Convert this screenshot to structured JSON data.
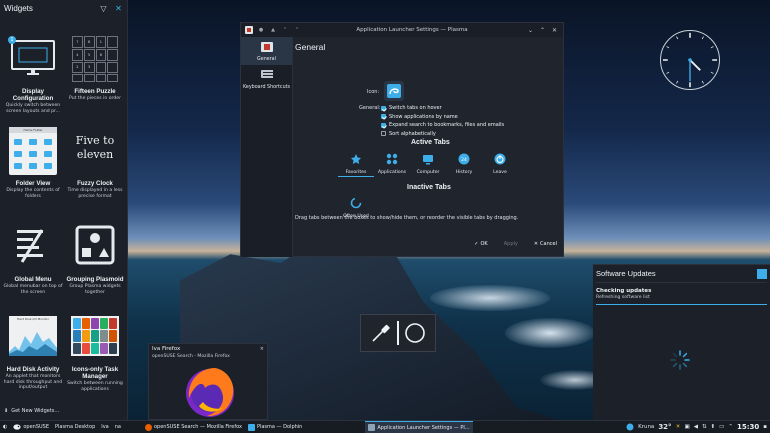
{
  "widgets_panel": {
    "title": "Widgets",
    "items": [
      {
        "name": "Display Configuration",
        "desc": "Quickly switch between screen layouts and pr...",
        "badge": "1"
      },
      {
        "name": "Fifteen Puzzle",
        "desc": "Put the pieces in order"
      },
      {
        "name": "Folder View",
        "desc": "Display the contents of folders",
        "thumb_label": "Home Folder"
      },
      {
        "name": "Fuzzy Clock",
        "desc": "Time displayed in a less precise format",
        "thumb_text_1": "Five to",
        "thumb_text_2": "eleven"
      },
      {
        "name": "Global Menu",
        "desc": "Global menubar on top of the screen"
      },
      {
        "name": "Grouping Plasmoid",
        "desc": "Group Plasma widgets together"
      },
      {
        "name": "Hard Disk Activity",
        "desc": "An applet that monitors hard disk throughput and input/output",
        "thumb_label": "Hard Disk I/O Monitor"
      },
      {
        "name": "Icons-only Task Manager",
        "desc": "Switch between running applications"
      }
    ],
    "puzzle_numbers": [
      "7",
      "8",
      "1",
      "",
      "4",
      "5",
      "6",
      "",
      "2",
      "3",
      "",
      "",
      "",
      "",
      "",
      ""
    ],
    "get_new": "Get New Widgets..."
  },
  "dialog": {
    "title": "Application Launcher Settings — Plasma",
    "sidebar": [
      {
        "label": "General"
      },
      {
        "label": "Keyboard Shortcuts"
      }
    ],
    "heading": "General",
    "icon_label": "Icon:",
    "general_label": "General:",
    "checks": [
      {
        "label": "Switch tabs on hover",
        "checked": true
      },
      {
        "label": "Show applications by name",
        "checked": true
      },
      {
        "label": "Expand search to bookmarks, files and emails",
        "checked": true
      },
      {
        "label": "Sort alphabetically",
        "checked": false
      }
    ],
    "active_tabs_label": "Active Tabs",
    "active_tabs": [
      {
        "label": "Favorites"
      },
      {
        "label": "Applications"
      },
      {
        "label": "Computer"
      },
      {
        "label": "History",
        "icon_text": "24"
      },
      {
        "label": "Leave"
      }
    ],
    "inactive_tabs_label": "Inactive Tabs",
    "inactive_tabs": [
      {
        "label": "Often Used"
      }
    ],
    "hint": "Drag tabs between the boxes to show/hide them, or reorder the visible tabs by dragging.",
    "buttons": {
      "ok": "OK",
      "apply": "Apply",
      "cancel": "Cancel"
    }
  },
  "clock": {
    "hour": 4,
    "minute": 30
  },
  "updates": {
    "title": "Software Updates",
    "status": "Checking updates",
    "substatus": "Refreshing software list"
  },
  "firefox_tooltip": {
    "title": "Iva Firefox",
    "subtitle": "openSUSE Search - Mozilla Firefox",
    "close": "×"
  },
  "taskbar": {
    "start": "openSUSE",
    "activity": "Plasma Desktop",
    "user1": "Iva",
    "user2": "na",
    "tasks": [
      {
        "label": "openSUSE Search — Mozilla Firefox",
        "color": "#e66000"
      },
      {
        "label": "Plasma — Dolphin",
        "color": "#3daee9"
      },
      {
        "label": "Application Launcher Settings — Pl...",
        "color": "#8fa3b8",
        "active": true
      }
    ],
    "weather_location": "Kruna",
    "temperature": "32°",
    "time": "15:30"
  },
  "colors": {
    "accent": "#3daee9",
    "panel": "#1b2029",
    "dialog": "#20242d"
  }
}
